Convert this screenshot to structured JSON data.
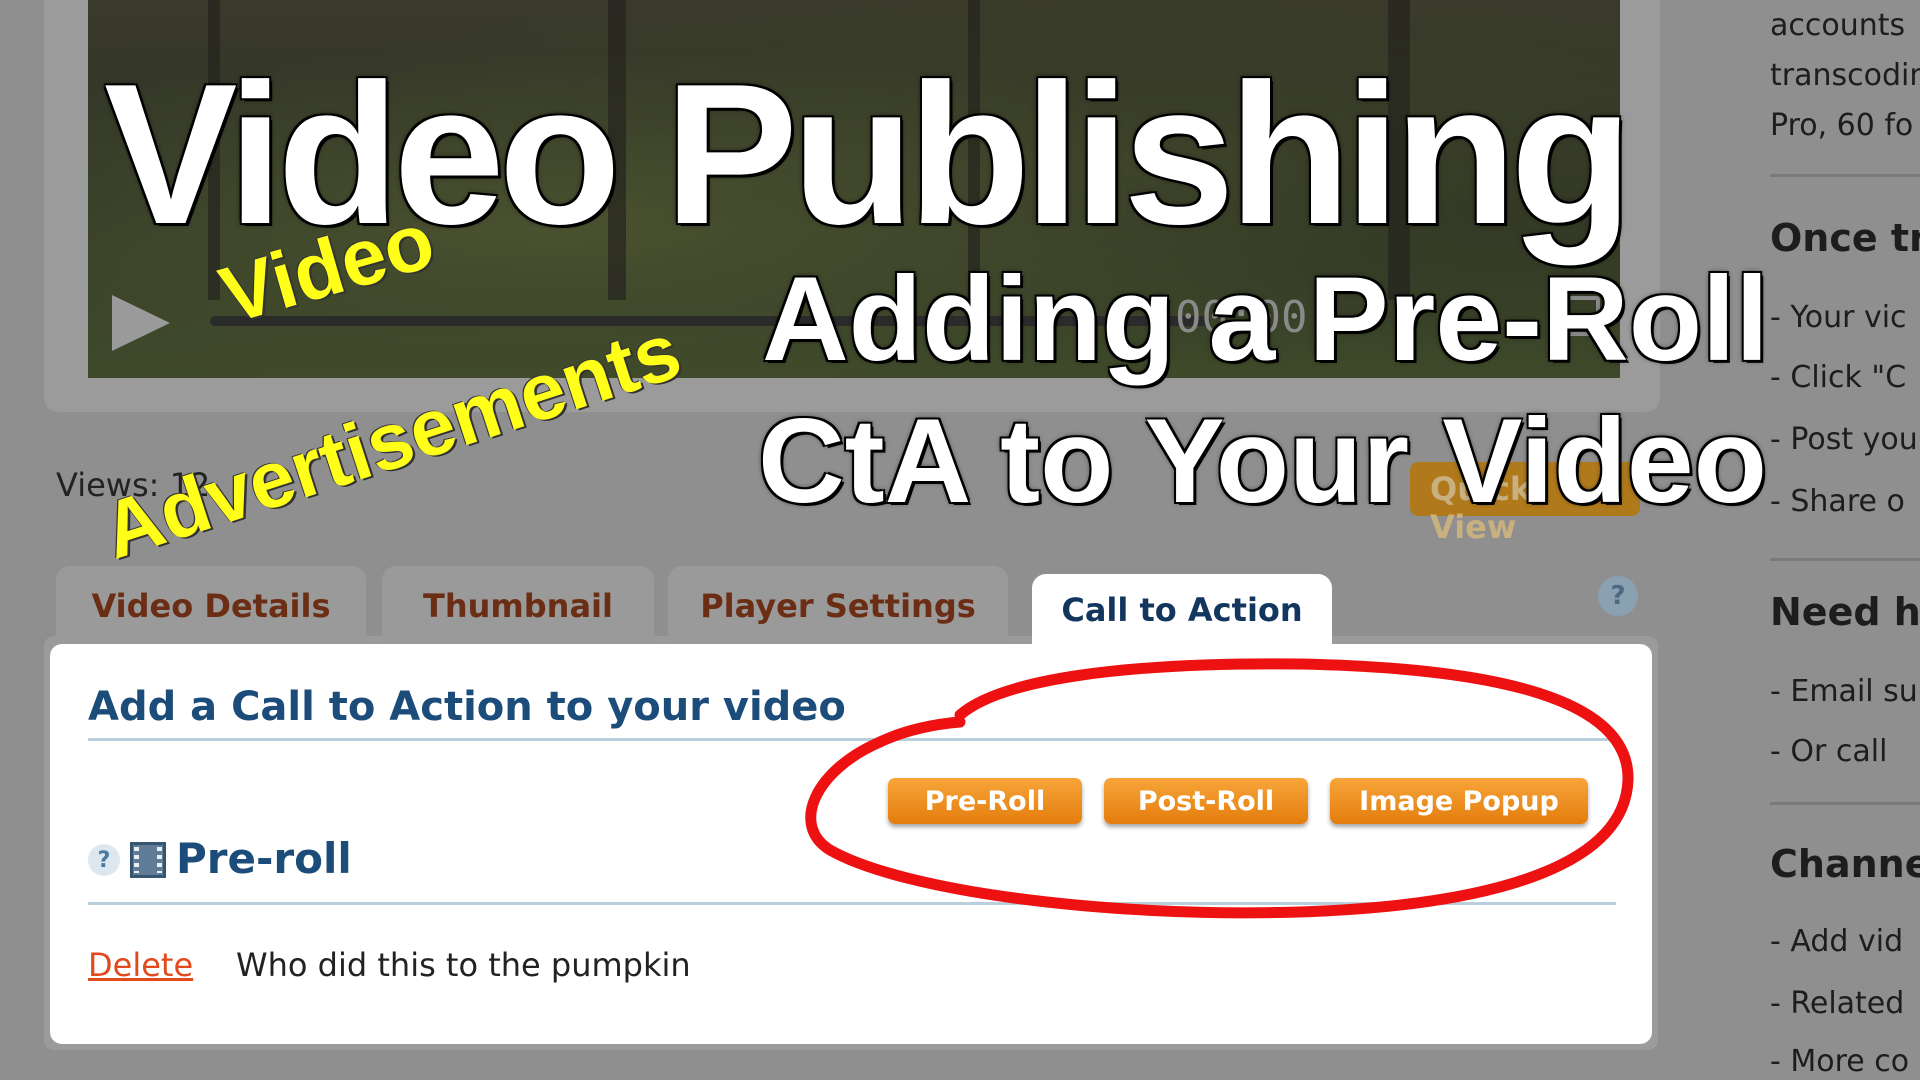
{
  "player": {
    "time": "00:00"
  },
  "meta": {
    "views": "Views: 12",
    "quick_view": "Quick View"
  },
  "tabs": [
    {
      "label": "Video Details"
    },
    {
      "label": "Thumbnail"
    },
    {
      "label": "Player Settings"
    },
    {
      "label": "Call to Action"
    }
  ],
  "help_dim": "?",
  "panel": {
    "title": "Add a Call to Action to your video",
    "buttons": {
      "pre_roll": "Pre-Roll",
      "post_roll": "Post-Roll",
      "image_popup": "Image Popup"
    },
    "help": "?",
    "section_heading": "Pre-roll",
    "delete_label": "Delete",
    "cta_name": "Who did this to the pumpkin"
  },
  "sidebar": {
    "lines": [
      "accounts",
      "transcodin",
      "Pro, 60 fo"
    ],
    "once_heading": "Once tr",
    "once_items": [
      "Your vic",
      "Click \"C",
      "Post you",
      "Share o"
    ],
    "need_heading": "Need he",
    "need_items": [
      "Email su",
      "Or call"
    ],
    "channel_heading": "Channel",
    "channel_items": [
      "Add vid",
      "Related",
      "More co"
    ],
    "bullet": "-"
  },
  "overlay": {
    "title": "Video Publishing",
    "line1": "Adding a Pre-Roll",
    "line2": "CtA to Your Video",
    "tag1": "Video",
    "tag2": "Advertisements"
  },
  "colors": {
    "accent_orange": "#e47d0d",
    "title_blue": "#1b4c7a",
    "delete_red": "#e04a1c",
    "highlight_red": "#ee1111",
    "tag_yellow": "#ffff1a"
  }
}
